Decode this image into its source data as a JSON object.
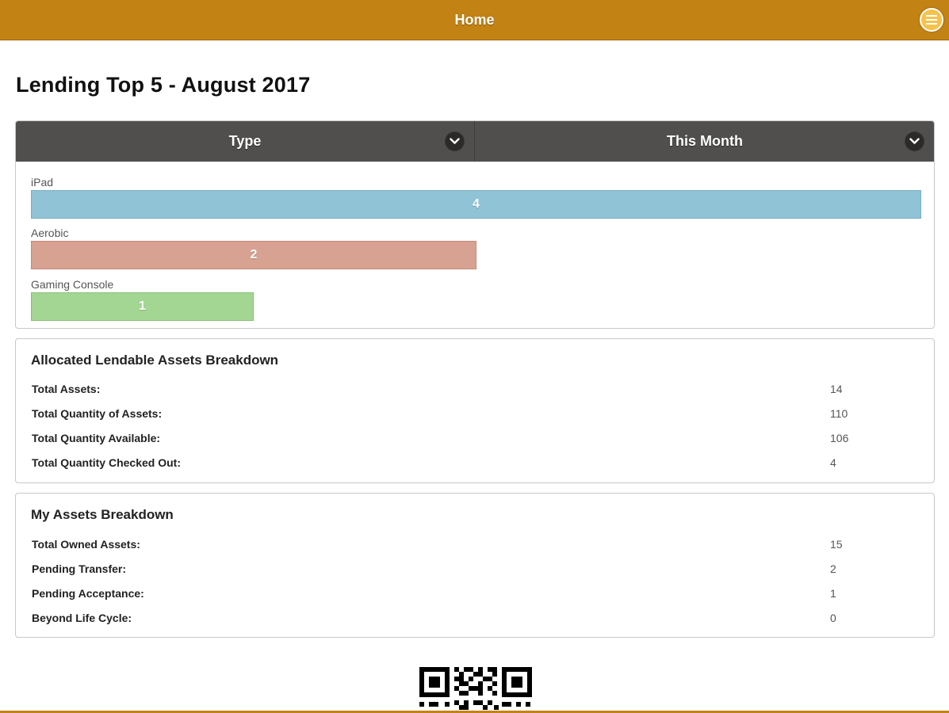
{
  "header": {
    "title": "Home",
    "menu_icon": "menu-icon"
  },
  "page_title": "Lending Top 5 - August 2017",
  "lending_table": {
    "columns": [
      {
        "label": "Type",
        "icon": "chevron-down-icon"
      },
      {
        "label": "This Month",
        "icon": "chevron-down-icon"
      }
    ],
    "max_value": 4,
    "items": [
      {
        "label": "iPad",
        "value": "4",
        "fraction": 1.0,
        "color": "#8fc3d5",
        "border": "#7aaec2"
      },
      {
        "label": "Aerobic",
        "value": "2",
        "fraction": 0.5,
        "color": "#d8a293",
        "border": "#c48a7b"
      },
      {
        "label": "Gaming Console",
        "value": "1",
        "fraction": 0.25,
        "color": "#a3d693",
        "border": "#86bf75"
      }
    ]
  },
  "allocated": {
    "title": "Allocated Lendable Assets Breakdown",
    "rows": [
      {
        "label": "Total Assets:",
        "value": "14"
      },
      {
        "label": "Total Quantity of Assets:",
        "value": "110"
      },
      {
        "label": "Total Quantity Available:",
        "value": "106"
      },
      {
        "label": "Total Quantity Checked Out:",
        "value": "4"
      }
    ]
  },
  "my_assets": {
    "title": "My Assets Breakdown",
    "rows": [
      {
        "label": "Total Owned Assets:",
        "value": "15"
      },
      {
        "label": "Pending Transfer:",
        "value": "2"
      },
      {
        "label": "Pending Acceptance:",
        "value": "1"
      },
      {
        "label": "Beyond Life Cycle:",
        "value": "0"
      }
    ]
  },
  "colors": {
    "brand": "#c28214",
    "table_header": "#514f4d"
  },
  "qr_icon": "qr-code-icon"
}
